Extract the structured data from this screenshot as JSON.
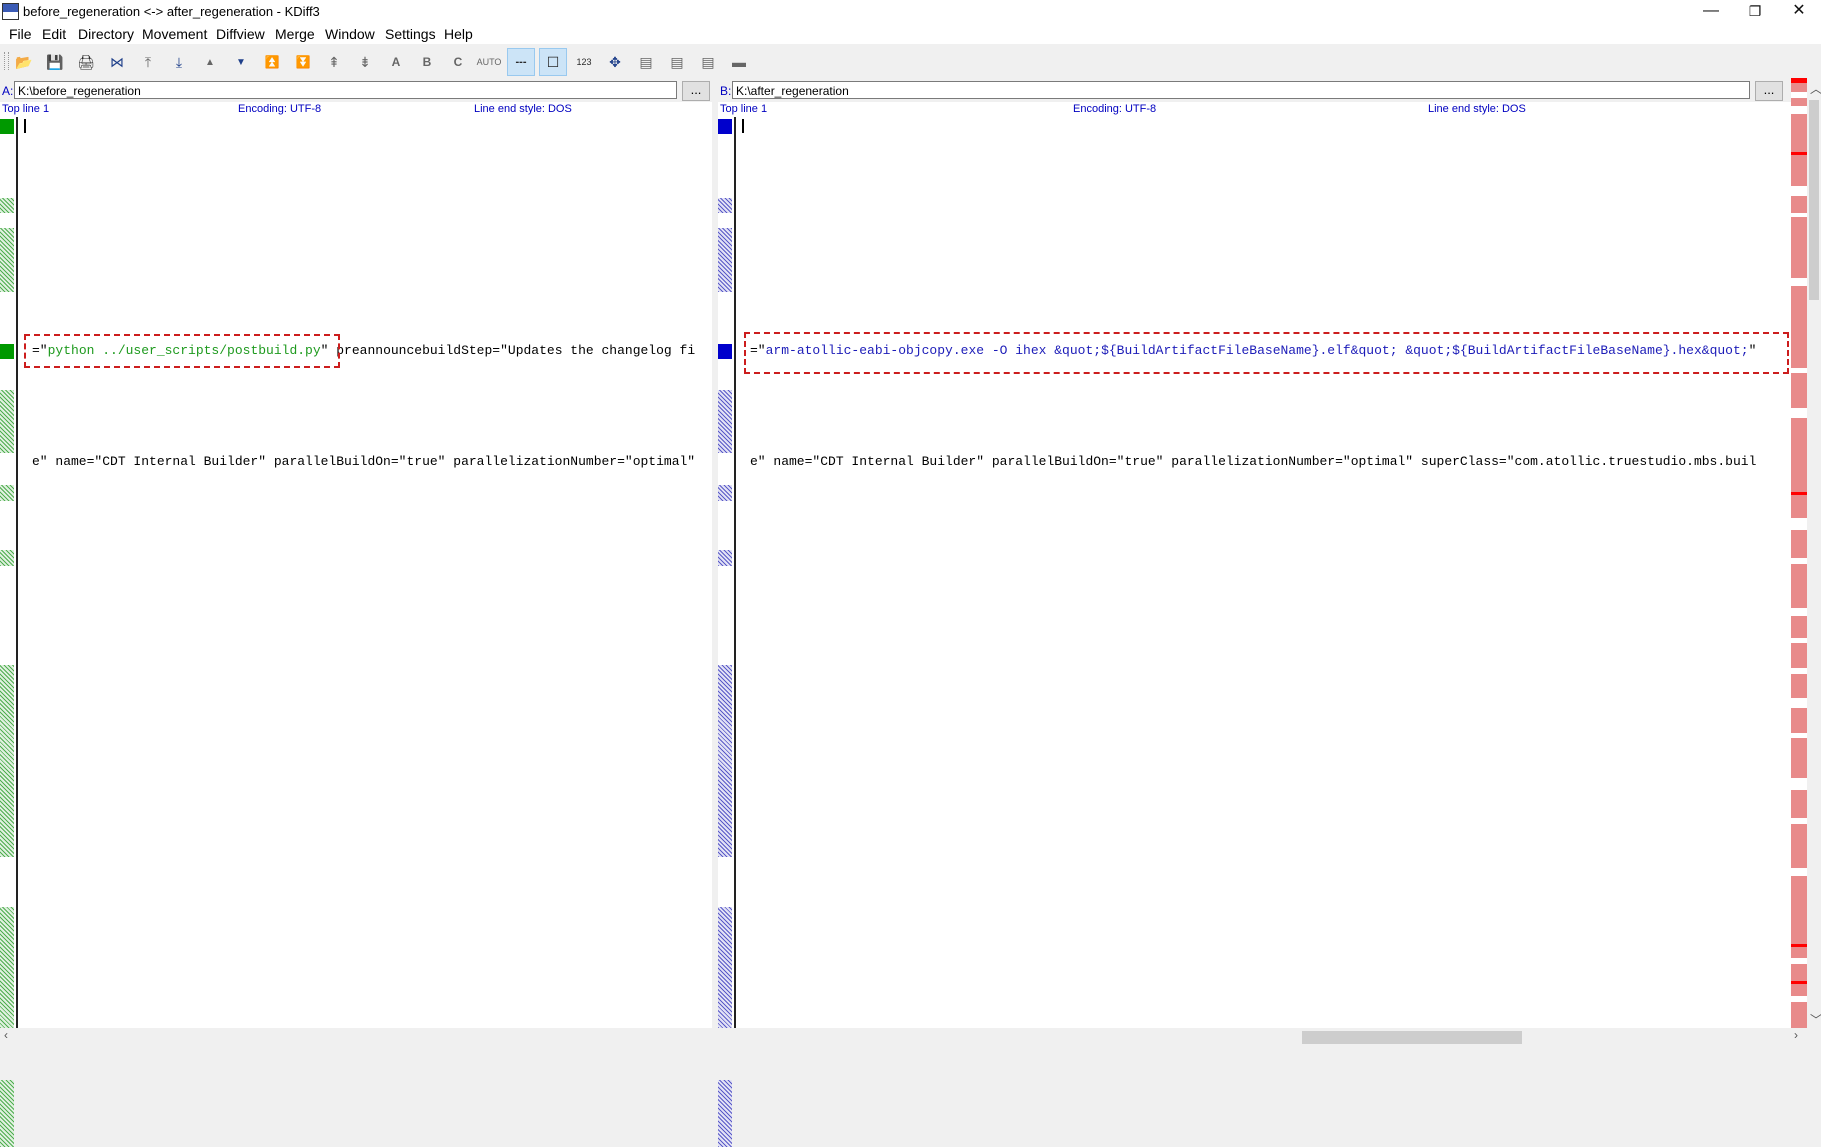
{
  "window": {
    "title": "before_regeneration <-> after_regeneration - KDiff3",
    "controls": {
      "minimize": "—",
      "restore": "❐",
      "close": "✕"
    }
  },
  "menu": [
    "File",
    "Edit",
    "Directory",
    "Movement",
    "Diffview",
    "Merge",
    "Window",
    "Settings",
    "Help"
  ],
  "toolbar": {
    "buttons": [
      {
        "name": "open-icon",
        "glyph": "📂"
      },
      {
        "name": "save-icon",
        "glyph": "💾"
      },
      {
        "name": "print-icon",
        "glyph": "🖨"
      },
      {
        "name": "goto-current-delta-icon",
        "glyph": "⋈"
      },
      {
        "name": "goto-first-delta-icon",
        "glyph": "⤒"
      },
      {
        "name": "goto-last-delta-icon",
        "glyph": "⤓"
      },
      {
        "name": "goto-prev-delta-icon",
        "glyph": "▲"
      },
      {
        "name": "goto-next-delta-icon",
        "glyph": "▼"
      },
      {
        "name": "goto-prev-conflict-icon",
        "glyph": "⏫"
      },
      {
        "name": "goto-next-conflict-icon",
        "glyph": "⏬"
      },
      {
        "name": "goto-prev-unsolved-conflict-icon",
        "glyph": "⇞"
      },
      {
        "name": "goto-next-unsolved-conflict-icon",
        "glyph": "⇟"
      },
      {
        "name": "select-a-icon",
        "glyph": "A"
      },
      {
        "name": "select-b-icon",
        "glyph": "B"
      },
      {
        "name": "select-c-icon",
        "glyph": "C"
      },
      {
        "name": "auto-advance-icon",
        "glyph": "AUTO"
      },
      {
        "name": "show-whitespace-icon",
        "glyph": "---"
      },
      {
        "name": "show-whitespace-chars-icon",
        "glyph": "☐"
      },
      {
        "name": "show-line-numbers-icon",
        "glyph": "123"
      },
      {
        "name": "choose-all-icon",
        "glyph": "✥"
      },
      {
        "name": "toggle-window-a-icon",
        "glyph": "▤"
      },
      {
        "name": "toggle-window-b-icon",
        "glyph": "▤"
      },
      {
        "name": "toggle-window-c-icon",
        "glyph": "▤"
      },
      {
        "name": "toggle-overview-icon",
        "glyph": "▬"
      }
    ]
  },
  "pane_a": {
    "label": "A:",
    "path": "K:\\before_regeneration",
    "browse": "...",
    "top_line": "Top line 1",
    "encoding": "Encoding: UTF-8",
    "line_end": "Line end style: DOS",
    "diff_line_prefix": "=\"",
    "diff_highlight": "python ../user_scripts/postbuild.py",
    "diff_suffix": "\" preannouncebuildStep=\"Updates the changelog fi",
    "context_line": "e\" name=\"CDT Internal Builder\" parallelBuildOn=\"true\" parallelizationNumber=\"optimal\""
  },
  "pane_b": {
    "label": "B:",
    "path": "K:\\after_regeneration",
    "browse": "...",
    "top_line": "Top line 1",
    "encoding": "Encoding: UTF-8",
    "line_end": "Line end style: DOS",
    "diff_line_prefix": "=\"",
    "diff_highlight": "arm-atollic-eabi-objcopy.exe -O ihex &quot;${BuildArtifactFileBaseName}.elf&quot; &quot;${BuildArtifactFileBaseName}.hex&quot;",
    "diff_suffix": "\"",
    "context_line": "e\" name=\"CDT Internal Builder\" parallelBuildOn=\"true\" parallelizationNumber=\"optimal\" superClass=\"com.atollic.truestudio.mbs.buil"
  },
  "colors": {
    "pane_a_accent": "#009900",
    "pane_b_accent": "#0000cc",
    "overview_diff": "#e88a8a",
    "annotation": "#cc1d1d"
  }
}
